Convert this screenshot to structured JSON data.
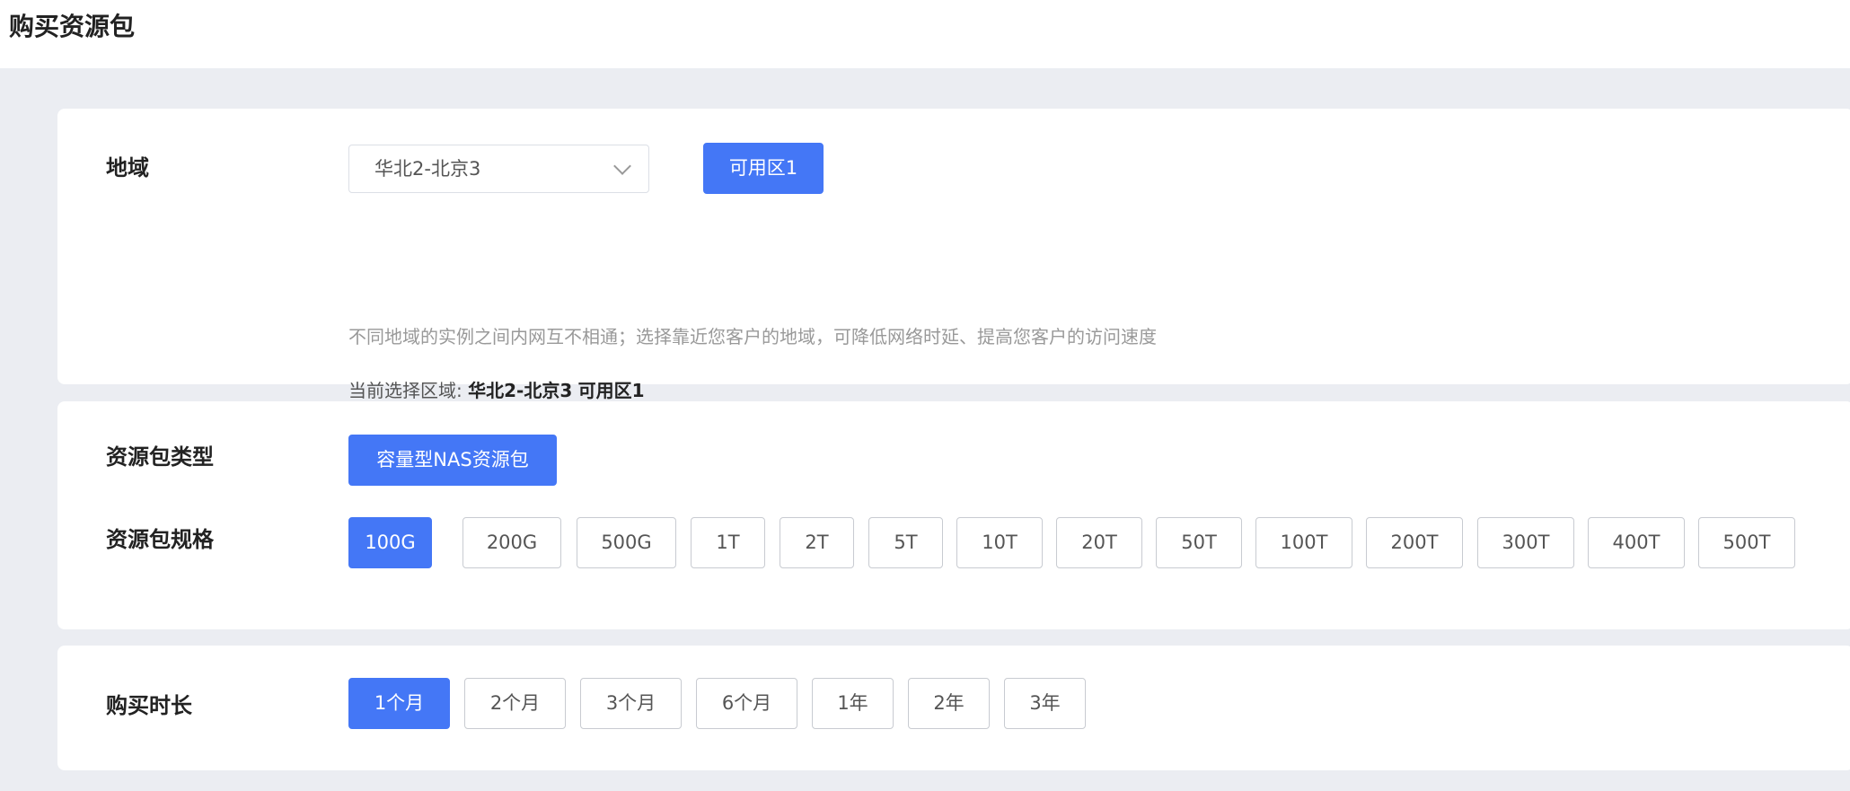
{
  "page": {
    "title": "购买资源包"
  },
  "region": {
    "label": "地域",
    "select_value": "华北2-北京3",
    "zone_button": "可用区1",
    "hint": "不同地域的实例之间内网互不相通；选择靠近您客户的地域，可降低网络时延、提高您客户的访问速度",
    "current_prefix": "当前选择区域:",
    "current_region": "华北2-北京3",
    "current_zone": "可用区1"
  },
  "package": {
    "type_label": "资源包类型",
    "type_button": "容量型NAS资源包",
    "spec_label": "资源包规格",
    "specs": [
      "100G",
      "200G",
      "500G",
      "1T",
      "2T",
      "5T",
      "10T",
      "20T",
      "50T",
      "100T",
      "200T",
      "300T",
      "400T",
      "500T"
    ],
    "selected_spec": "100G"
  },
  "duration": {
    "label": "购买时长",
    "options": [
      "1个月",
      "2个月",
      "3个月",
      "6个月",
      "1年",
      "2年",
      "3年"
    ],
    "selected": "1个月"
  },
  "colors": {
    "accent": "#4477f6",
    "background": "#ebedf2"
  }
}
